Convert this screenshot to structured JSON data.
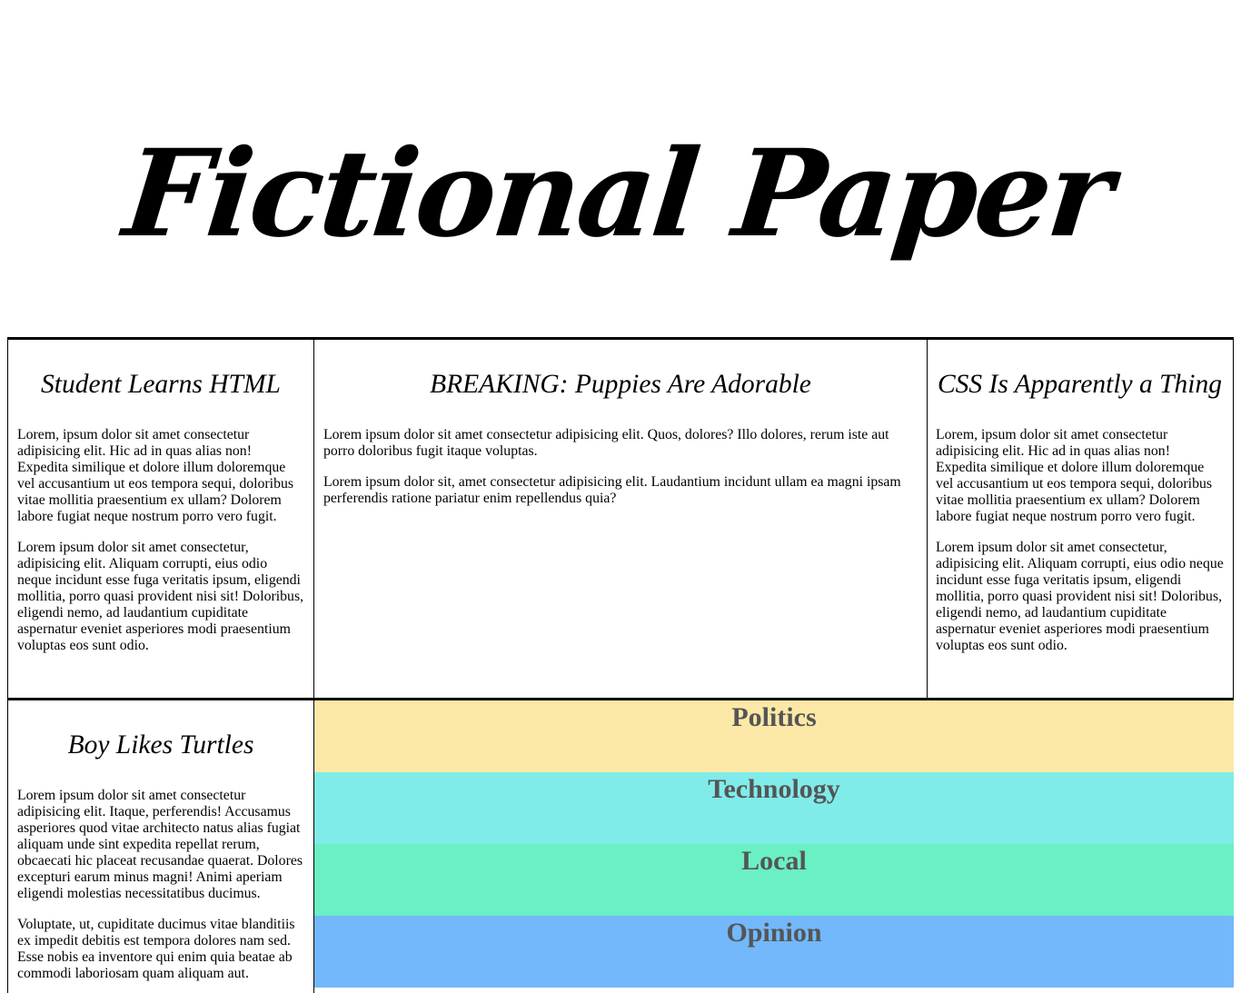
{
  "masthead": {
    "title": "Fictional Paper"
  },
  "articles": [
    {
      "headline": "Student Learns HTML",
      "paragraphs": [
        "Lorem, ipsum dolor sit amet consectetur adipisicing elit. Hic ad in quas alias non! Expedita similique et dolore illum doloremque vel accusantium ut eos tempora sequi, doloribus vitae mollitia praesentium ex ullam? Dolorem labore fugiat neque nostrum porro vero fugit.",
        "Lorem ipsum dolor sit amet consectetur, adipisicing elit. Aliquam corrupti, eius odio neque incidunt esse fuga veritatis ipsum, eligendi mollitia, porro quasi provident nisi sit! Doloribus, eligendi nemo, ad laudantium cupiditate aspernatur eveniet asperiores modi praesentium voluptas eos sunt odio."
      ]
    },
    {
      "headline": "BREAKING: Puppies Are Adorable",
      "paragraphs": [
        "Lorem ipsum dolor sit amet consectetur adipisicing elit. Quos, dolores? Illo dolores, rerum iste aut porro doloribus fugit itaque voluptas.",
        "Lorem ipsum dolor sit, amet consectetur adipisicing elit. Laudantium incidunt ullam ea magni ipsam perferendis ratione pariatur enim repellendus quia?"
      ]
    },
    {
      "headline": "CSS Is Apparently a Thing",
      "paragraphs": [
        "Lorem, ipsum dolor sit amet consectetur adipisicing elit. Hic ad in quas alias non! Expedita similique et dolore illum doloremque vel accusantium ut eos tempora sequi, doloribus vitae mollitia praesentium ex ullam? Dolorem labore fugiat neque nostrum porro vero fugit.",
        "Lorem ipsum dolor sit amet consectetur, adipisicing elit. Aliquam corrupti, eius odio neque incidunt esse fuga veritatis ipsum, eligendi mollitia, porro quasi provident nisi sit! Doloribus, eligendi nemo, ad laudantium cupiditate aspernatur eveniet asperiores modi praesentium voluptas eos sunt odio."
      ]
    },
    {
      "headline": "Boy Likes Turtles",
      "paragraphs": [
        "Lorem ipsum dolor sit amet consectetur adipisicing elit. Itaque, perferendis! Accusamus asperiores quod vitae architecto natus alias fugiat aliquam unde sint expedita repellat rerum, obcaecati hic placeat recusandae quaerat. Dolores excepturi earum minus magni! Animi aperiam eligendi molestias necessitatibus ducimus.",
        "Voluptate, ut, cupiditate ducimus vitae blanditiis ex impedit debitis est tempora dolores nam sed. Esse nobis ea inventore qui enim quia beatae ab commodi laboriosam quam aliquam aut."
      ]
    }
  ],
  "sections": [
    {
      "label": "Politics",
      "color": "#fce8a6"
    },
    {
      "label": "Technology",
      "color": "#80ecea"
    },
    {
      "label": "Local",
      "color": "#6af0c4"
    },
    {
      "label": "Opinion",
      "color": "#72b8fb"
    }
  ]
}
